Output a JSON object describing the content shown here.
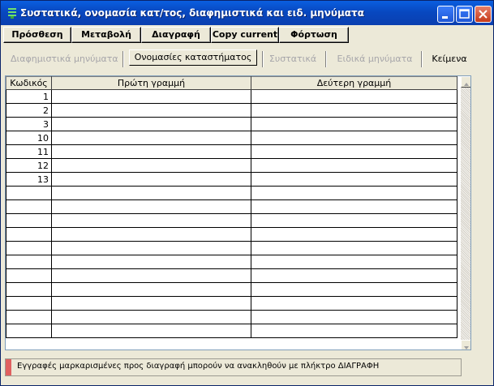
{
  "window": {
    "title": "Συστατικά, ονομασία κατ/τος, διαφημιστικά και ειδ. μηνύματα",
    "icon": "menu-lines-icon",
    "titlebar_color": "#0a5fe0",
    "close_color": "#c63a1a"
  },
  "toolbar": {
    "add_label": "Πρόσθεση",
    "modify_label": "Μεταβολή",
    "delete_label": "Διαγραφή",
    "copy_label": "Copy current",
    "load_label": "Φόρτωση"
  },
  "tabs": {
    "ads": "Διαφημιστικά μηνύματα",
    "store_names": "Ονομασίες καταστήματος",
    "ingredients": "Συστατικά",
    "special": "Ειδικά μηνύματα",
    "texts": "Κείμενα"
  },
  "grid": {
    "headers": [
      "Κωδικός",
      "Πρώτη γραμμή",
      "Δεύτερη γραμμή"
    ],
    "codes": [
      "1",
      "2",
      "3",
      "10",
      "11",
      "12",
      "13"
    ],
    "empty_rows": 11
  },
  "status": {
    "text": "Εγγραφές μαρκαρισμένες προς διαγραφή μπορούν να ανακληθούν με πλήκτρο ΔΙΑΓΡΑΦΗ",
    "stripe_color": "#e06060"
  }
}
